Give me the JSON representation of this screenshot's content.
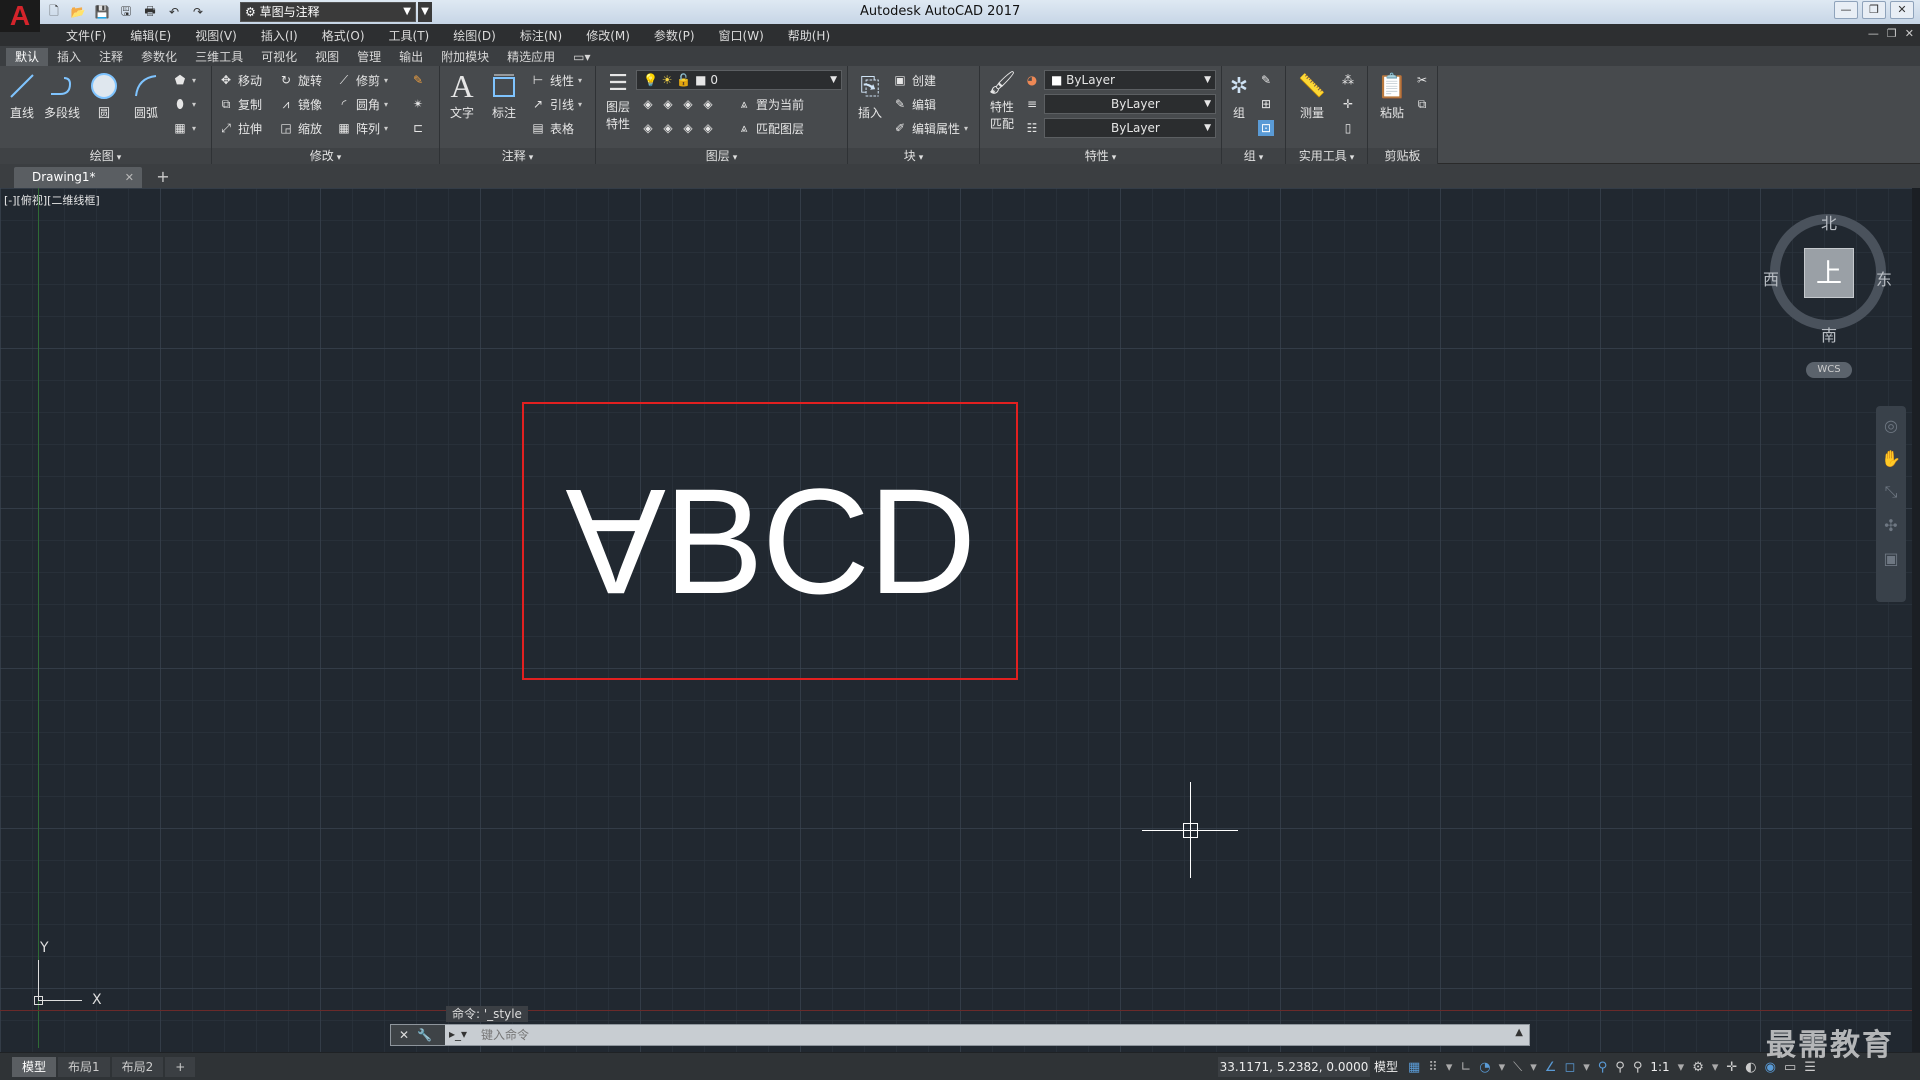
{
  "app": {
    "logo": "A",
    "title": "Autodesk AutoCAD 2017",
    "workspace": "草图与注释"
  },
  "menus": [
    "文件(F)",
    "编辑(E)",
    "视图(V)",
    "插入(I)",
    "格式(O)",
    "工具(T)",
    "绘图(D)",
    "标注(N)",
    "修改(M)",
    "参数(P)",
    "窗口(W)",
    "帮助(H)"
  ],
  "ribbon_tabs": [
    "默认",
    "插入",
    "注释",
    "参数化",
    "三维工具",
    "可视化",
    "视图",
    "管理",
    "输出",
    "附加模块",
    "精选应用"
  ],
  "panels": {
    "draw": {
      "title": "绘图",
      "line": "直线",
      "polyline": "多段线",
      "circle": "圆",
      "arc": "圆弧"
    },
    "modify": {
      "title": "修改",
      "move": "移动",
      "rotate": "旋转",
      "trim": "修剪",
      "copy": "复制",
      "mirror": "镜像",
      "fillet": "圆角",
      "stretch": "拉伸",
      "scale": "缩放",
      "array": "阵列"
    },
    "annotation": {
      "title": "注释",
      "text": "文字",
      "dimension": "标注",
      "linear": "线性",
      "leader": "引线",
      "table": "表格"
    },
    "layers": {
      "title": "图层",
      "properties_line1": "图层",
      "properties_line2": "特性",
      "current_layer": "0",
      "set_current": "置为当前",
      "match_layer": "匹配图层"
    },
    "block": {
      "title": "块",
      "insert": "插入",
      "create": "创建",
      "edit": "编辑",
      "edit_attributes": "编辑属性"
    },
    "properties": {
      "title": "特性",
      "match_line1": "特性",
      "match_line2": "匹配",
      "color": "ByLayer",
      "linetype": "ByLayer",
      "lineweight": "ByLayer"
    },
    "groups": {
      "title": "组",
      "group": "组"
    },
    "utilities": {
      "title": "实用工具",
      "measure": "测量"
    },
    "clipboard": {
      "title": "剪贴板",
      "paste": "粘贴"
    }
  },
  "file_tab": {
    "name": "Drawing1*"
  },
  "viewport": {
    "label": "[-][俯视][二维线框]"
  },
  "drawing": {
    "text_first": "A",
    "text_rest": "BCD",
    "rect_color": "#e22020"
  },
  "ucs": {
    "x": "X",
    "y": "Y"
  },
  "viewcube": {
    "top": "上",
    "north": "北",
    "south": "南",
    "east": "东",
    "west": "西",
    "wcs": "WCS"
  },
  "command": {
    "history": "命令: '_style",
    "placeholder": "键入命令"
  },
  "layouts": [
    "模型",
    "布局1",
    "布局2"
  ],
  "status": {
    "coords": "33.1171, 5.2382, 0.0000",
    "model": "模型",
    "scale": "1:1"
  },
  "watermark": "最需教育"
}
